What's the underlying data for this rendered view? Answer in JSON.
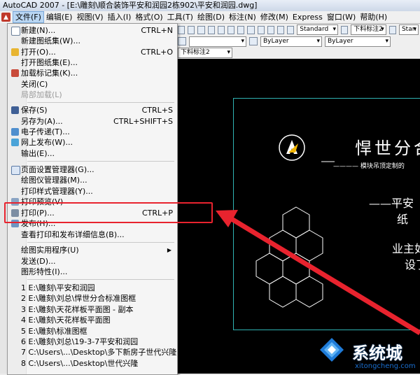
{
  "window": {
    "title": "AutoCAD 2007 - [E:\\雕刻\\顺合装饰平安和润园2栋902\\平安和润园.dwg]"
  },
  "menubar": [
    {
      "label": "文件(F)",
      "active": true
    },
    {
      "label": "编辑(E)"
    },
    {
      "label": "视图(V)"
    },
    {
      "label": "插入(I)"
    },
    {
      "label": "格式(O)"
    },
    {
      "label": "工具(T)"
    },
    {
      "label": "绘图(D)"
    },
    {
      "label": "标注(N)"
    },
    {
      "label": "修改(M)"
    },
    {
      "label": "Express"
    },
    {
      "label": "窗口(W)"
    },
    {
      "label": "帮助(H)"
    }
  ],
  "toolbar": {
    "text_style": "Standard",
    "dim_style": "下料标注2",
    "extra": "Stan",
    "layer_color": "ByLayer",
    "layer_linetype": "ByLayer",
    "dim_style_2": "下料标注2"
  },
  "file_menu": {
    "items": [
      {
        "label": "新建(N)...",
        "shortcut": "CTRL+N",
        "icon": "new-file-icon"
      },
      {
        "label": "新建图纸集(W)...",
        "shortcut": ""
      },
      {
        "label": "打开(O)...",
        "shortcut": "CTRL+O",
        "icon": "open-folder-icon"
      },
      {
        "label": "打开图纸集(E)...",
        "shortcut": ""
      },
      {
        "label": "加载标记集(K)...",
        "shortcut": "",
        "icon": "markup-icon"
      },
      {
        "label": "关闭(C)",
        "shortcut": ""
      },
      {
        "label": "局部加载(L)",
        "shortcut": "",
        "disabled": true
      },
      {
        "label": "保存(S)",
        "shortcut": "CTRL+S",
        "icon": "save-icon"
      },
      {
        "label": "另存为(A)...",
        "shortcut": "CTRL+SHIFT+S"
      },
      {
        "label": "电子传递(T)...",
        "shortcut": "",
        "icon": "etransmit-icon"
      },
      {
        "label": "网上发布(W)...",
        "shortcut": "",
        "icon": "web-publish-icon"
      },
      {
        "label": "输出(E)...",
        "shortcut": ""
      },
      {
        "label": "页面设置管理器(G)...",
        "shortcut": "",
        "icon": "page-setup-icon"
      },
      {
        "label": "绘图仪管理器(M)...",
        "shortcut": ""
      },
      {
        "label": "打印样式管理器(Y)...",
        "shortcut": ""
      },
      {
        "label": "打印预览(V)",
        "shortcut": "",
        "icon": "preview-icon"
      },
      {
        "label": "打印(P)...",
        "shortcut": "CTRL+P",
        "icon": "print-icon"
      },
      {
        "label": "发布(H)...",
        "shortcut": "",
        "icon": "publish-icon"
      },
      {
        "label": "查看打印和发布详细信息(B)...",
        "shortcut": ""
      },
      {
        "label": "绘图实用程序(U)",
        "shortcut": "",
        "submenu": true
      },
      {
        "label": "发送(D)...",
        "shortcut": ""
      },
      {
        "label": "图形特性(I)...",
        "shortcut": ""
      },
      {
        "label": "1 E:\\雕刻\\平安和润园",
        "shortcut": ""
      },
      {
        "label": "2 E:\\雕刻\\刘总\\悍世分合标准图框",
        "shortcut": ""
      },
      {
        "label": "3 E:\\雕刻\\天花样板平面图 - 副本",
        "shortcut": ""
      },
      {
        "label": "4 E:\\雕刻\\天花样板平面图",
        "shortcut": ""
      },
      {
        "label": "5 E:\\雕刻\\标准图框",
        "shortcut": ""
      },
      {
        "label": "6 E:\\雕刻\\刘总\\19-3-7平安和润园",
        "shortcut": ""
      },
      {
        "label": "7 C:\\Users\\...\\Desktop\\多下新房子世代兴隆",
        "shortcut": ""
      },
      {
        "label": "8 C:\\Users\\...\\Desktop\\世代兴隆",
        "shortcut": ""
      }
    ]
  },
  "drawing": {
    "title": "悍世分合",
    "subtitle": "———— 模块吊顶定制的",
    "line1": "——平安",
    "line2": "纸",
    "line3": "业主如",
    "line4": "设了"
  },
  "watermark": {
    "brand": "系统城",
    "url": "xitongcheng.com"
  },
  "colors": {
    "highlight_red": "#e8232e",
    "frame_teal": "#2fb3b3",
    "canvas_bg": "#000000"
  }
}
